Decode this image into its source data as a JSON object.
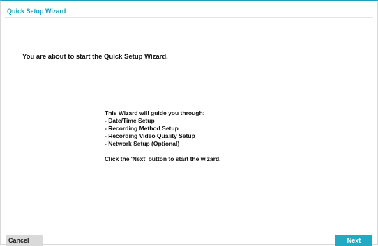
{
  "window": {
    "title": "Quick Setup Wizard"
  },
  "content": {
    "intro": "You are about to start the Quick Setup Wizard.",
    "guide_heading": "This Wizard will guide you through:",
    "guide_items": [
      "- Date/Time Setup",
      "- Recording Method Setup",
      "- Recording Video Quality Setup",
      "- Network Setup (Optional)"
    ],
    "instruction": "Click the 'Next' button to start the wizard."
  },
  "buttons": {
    "cancel_label": "Cancel",
    "next_label": "Next"
  },
  "colors": {
    "accent": "#1a9fbb",
    "next_button": "#22a9c4",
    "cancel_button": "#d9d9d9"
  }
}
